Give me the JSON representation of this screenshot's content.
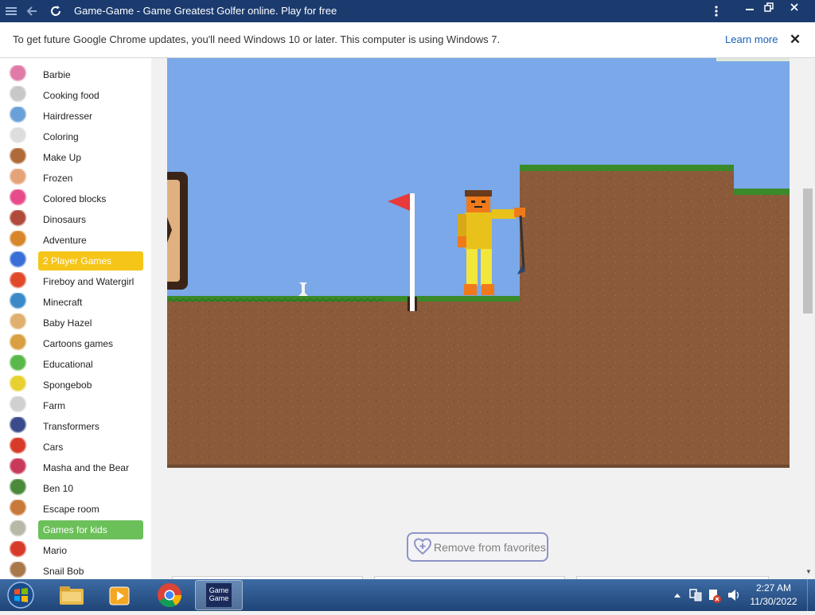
{
  "window": {
    "title": "Game-Game - Game Greatest Golfer online. Play for free",
    "icons": [
      "app-menu-icon",
      "back-arrow-icon",
      "reload-icon",
      "kebab-menu-icon",
      "minimize-icon",
      "restore-icon",
      "close-icon"
    ]
  },
  "infobar": {
    "message": "To get future Google Chrome updates, you'll need Windows 10 or later. This computer is using Windows 7.",
    "learn_more": "Learn more",
    "close_glyph": "✕"
  },
  "sidebar": {
    "items": [
      {
        "label": "Barbie",
        "icon": "barbie-icon",
        "color": "#e07aa6"
      },
      {
        "label": "Cooking food",
        "icon": "chef-icon",
        "color": "#c8c8c8"
      },
      {
        "label": "Hairdresser",
        "icon": "scissors-icon",
        "color": "#6aa0d8"
      },
      {
        "label": "Coloring",
        "icon": "coloring-icon",
        "color": "#dddddd"
      },
      {
        "label": "Make Up",
        "icon": "makeup-icon",
        "color": "#b06a3a"
      },
      {
        "label": "Frozen",
        "icon": "frozen-icon",
        "color": "#e6a37a"
      },
      {
        "label": "Colored blocks",
        "icon": "colored-blocks-icon",
        "color": "#e84b8a"
      },
      {
        "label": "Dinosaurs",
        "icon": "dinosaur-icon",
        "color": "#b04a3a"
      },
      {
        "label": "Adventure",
        "icon": "adventure-icon",
        "color": "#d8862a"
      },
      {
        "label": "2 Player Games",
        "icon": "two-player-icon",
        "color": "#3a6fd8",
        "highlight": "#f5c518"
      },
      {
        "label": "Fireboy and Watergirl",
        "icon": "fireboy-watergirl-icon",
        "color": "#e04a2a"
      },
      {
        "label": "Minecraft",
        "icon": "minecraft-icon",
        "color": "#3a8ac8"
      },
      {
        "label": "Baby Hazel",
        "icon": "baby-hazel-icon",
        "color": "#e0b070"
      },
      {
        "label": "Cartoons games",
        "icon": "cartoon-icon",
        "color": "#d8a040"
      },
      {
        "label": "Educational",
        "icon": "educational-icon",
        "color": "#5ab84a"
      },
      {
        "label": "Spongebob",
        "icon": "spongebob-icon",
        "color": "#e8d030"
      },
      {
        "label": "Farm",
        "icon": "farm-sheep-icon",
        "color": "#d0d0d0"
      },
      {
        "label": "Transformers",
        "icon": "transformers-icon",
        "color": "#3a4a8a"
      },
      {
        "label": "Cars",
        "icon": "cars-icon",
        "color": "#d83a2a"
      },
      {
        "label": "Masha and the Bear",
        "icon": "masha-icon",
        "color": "#c83a5a"
      },
      {
        "label": "Ben 10",
        "icon": "ben10-icon",
        "color": "#4a8a3a"
      },
      {
        "label": "Escape room",
        "icon": "escape-room-icon",
        "color": "#c87a3a"
      },
      {
        "label": "Games for kids",
        "icon": "kids-icon",
        "color": "#b8b8a8",
        "highlight": "#6cc05a"
      },
      {
        "label": "Mario",
        "icon": "mario-icon",
        "color": "#d83a2a"
      },
      {
        "label": "Snail Bob",
        "icon": "snail-bob-icon",
        "color": "#a8784a"
      }
    ]
  },
  "game": {
    "name": "Greatest Golfer",
    "colors": {
      "sky": "#7aa8e8",
      "dirt": "#8a5a3a",
      "grass": "#3a8a2a",
      "flag": "#e83a3a"
    }
  },
  "favorites": {
    "label": "Remove from favorites",
    "border_color": "#8e93c8"
  },
  "taskbar": {
    "apps": [
      "windows-start-icon",
      "file-explorer-icon",
      "media-player-icon",
      "chrome-icon",
      "game-game-icon"
    ],
    "active_app_label": "Game Game",
    "time": "2:27 AM",
    "date": "11/30/2022",
    "tray_icons": [
      "tray-up-arrow-icon",
      "network-icon",
      "action-center-icon",
      "volume-icon"
    ]
  }
}
